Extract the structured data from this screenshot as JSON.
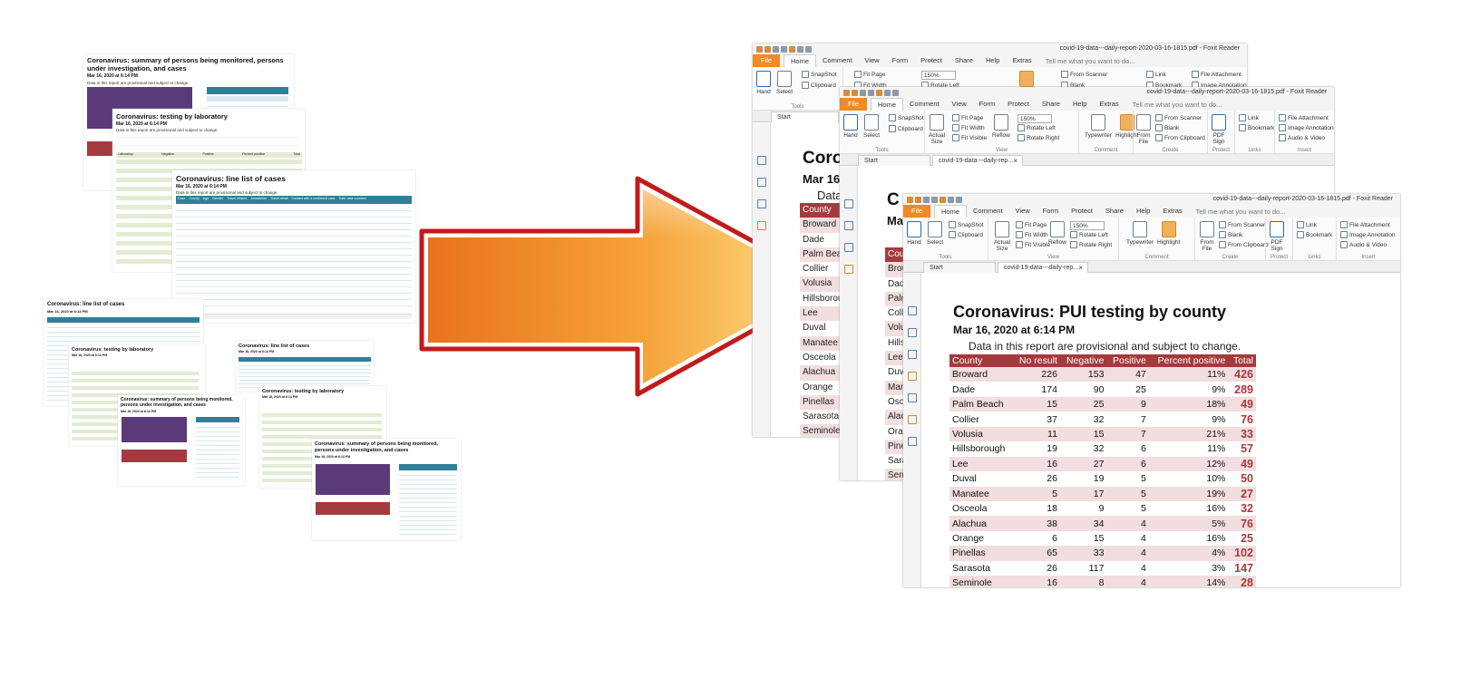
{
  "thumbnails": {
    "summary_doc": {
      "title": "Coronavirus: summary of persons being monitored, persons under investigation, and cases",
      "date": "Mar 16, 2020 at 6:14 PM",
      "note": "Data in this report are provisional and subject to change."
    },
    "lab_doc": {
      "title": "Coronavirus: testing by laboratory",
      "date": "Mar 16, 2020 at 6:14 PM",
      "note": "Data in this report are provisional and subject to change.",
      "columns": [
        "Laboratory",
        "Negative",
        "Positive",
        "Percent positive",
        "Total"
      ]
    },
    "cases_doc": {
      "title": "Coronavirus: line list of cases",
      "date": "Mar 16, 2020 at 6:14 PM",
      "note": "Data in this report are provisional and subject to change.",
      "columns": [
        "Case",
        "County",
        "Age",
        "Gender",
        "Travel related",
        "Jurisdiction",
        "Travel detail",
        "Contact with a confirmed case",
        "Date case counted"
      ]
    },
    "small_cases_doc": {
      "title": "Coronavirus: line list of cases",
      "date": "Mar 16, 2020 at 6:14 PM"
    },
    "small_lab_doc": {
      "title": "Coronavirus: testing by laboratory",
      "date": "Mar 16, 2020 at 6:14 PM"
    },
    "small_summary_doc": {
      "title": "Coronavirus: summary of persons being monitored, persons under investigation, and cases",
      "date": "Mar 16, 2020 at 6:14 PM"
    },
    "small_cases_doc_2": {
      "title": "Coronavirus: line list of cases",
      "date": "Mar 16, 2020 at 6:14 PM"
    },
    "small_lab_doc_2": {
      "title": "Coronavirus: testing by laboratory",
      "date": "Mar 16, 2020 at 6:14 PM"
    },
    "small_summary_doc_2": {
      "title": "Coronavirus: summary of persons being monitored, persons under investigation, and cases",
      "date": "Mar 16, 2020 at 6:14 PM"
    }
  },
  "app": {
    "window_title": "covid-19-data---daily-report-2020-03-16-1815.pdf - Foxit Reader",
    "menu": [
      "File",
      "Home",
      "Comment",
      "View",
      "Form",
      "Protect",
      "Share",
      "Help",
      "Extras"
    ],
    "tell_me": "Tell me what you want to do...",
    "ribbon": {
      "hand": "Hand",
      "select": "Select",
      "snapshot": "SnapShot",
      "clipboard": "Clipboard",
      "tools_label": "Tools",
      "actual_size": "Actual Size",
      "fit_page": "Fit Page",
      "fit_width": "Fit Width",
      "fit_visible": "Fit Visible",
      "reflow": "Reflow",
      "zoom": "150%",
      "rotate_left": "Rotate Left",
      "rotate_right": "Rotate Right",
      "view_label": "View",
      "typewriter": "Typewriter",
      "highlight": "Highlight",
      "comment_label": "Comment",
      "from_file": "From File",
      "from_scanner": "From Scanner",
      "blank": "Blank",
      "from_clipboard": "From Clipboard",
      "create_label": "Create",
      "pdf_sign": "PDF Sign",
      "protect_label": "Protect",
      "link": "Link",
      "bookmark": "Bookmark",
      "links_label": "Links",
      "file_attachment": "File Attachment",
      "image_annotation": "Image Annotation",
      "audio_video": "Audio & Video",
      "insert_label": "Insert"
    },
    "tabs": {
      "start": "Start",
      "doc": "covid-19-data---daily-rep..."
    }
  },
  "back_window": {
    "title_fragment": "Coro",
    "date_fragment": "Mar 16,",
    "note_fragment": "Data",
    "counties": [
      "County",
      "Broward",
      "Dade",
      "Palm Beac",
      "Collier",
      "Volusia",
      "Hillsborou",
      "Lee",
      "Duval",
      "Manatee",
      "Osceola",
      "Alachua",
      "Orange",
      "Pinellas",
      "Sarasota",
      "Seminole"
    ]
  },
  "mid_window": {
    "title_fragment": "C",
    "date_fragment": "Ma",
    "counties": [
      "Cou",
      "Brow",
      "Dad",
      "Palm",
      "Coll",
      "Volu",
      "Hills",
      "Lee",
      "Duv",
      "Man",
      "Osc",
      "Alac",
      "Oran",
      "Pine",
      "Sara",
      "Sem"
    ]
  },
  "report": {
    "title": "Coronavirus: PUI testing by county",
    "date": "Mar 16, 2020 at 6:14 PM",
    "note": "Data in this report are provisional and subject to change.",
    "columns": [
      "County",
      "No result",
      "Negative",
      "Positive",
      "Percent positive",
      "Total"
    ],
    "rows": [
      [
        "Broward",
        "226",
        "153",
        "47",
        "11%",
        "426"
      ],
      [
        "Dade",
        "174",
        "90",
        "25",
        "9%",
        "289"
      ],
      [
        "Palm Beach",
        "15",
        "25",
        "9",
        "18%",
        "49"
      ],
      [
        "Collier",
        "37",
        "32",
        "7",
        "9%",
        "76"
      ],
      [
        "Volusia",
        "11",
        "15",
        "7",
        "21%",
        "33"
      ],
      [
        "Hillsborough",
        "19",
        "32",
        "6",
        "11%",
        "57"
      ],
      [
        "Lee",
        "16",
        "27",
        "6",
        "12%",
        "49"
      ],
      [
        "Duval",
        "26",
        "19",
        "5",
        "10%",
        "50"
      ],
      [
        "Manatee",
        "5",
        "17",
        "5",
        "19%",
        "27"
      ],
      [
        "Osceola",
        "18",
        "9",
        "5",
        "16%",
        "32"
      ],
      [
        "Alachua",
        "38",
        "34",
        "4",
        "5%",
        "76"
      ],
      [
        "Orange",
        "6",
        "15",
        "4",
        "16%",
        "25"
      ],
      [
        "Pinellas",
        "65",
        "33",
        "4",
        "4%",
        "102"
      ],
      [
        "Sarasota",
        "26",
        "117",
        "4",
        "3%",
        "147"
      ],
      [
        "Seminole",
        "16",
        "8",
        "4",
        "14%",
        "28"
      ]
    ]
  },
  "colors": {
    "accent_red": "#a53a3e",
    "row_stripe": "#f2dede",
    "foxit_orange": "#f08a24",
    "arrow_orange": "#f29a2e",
    "arrow_outline": "#c21a1a"
  }
}
